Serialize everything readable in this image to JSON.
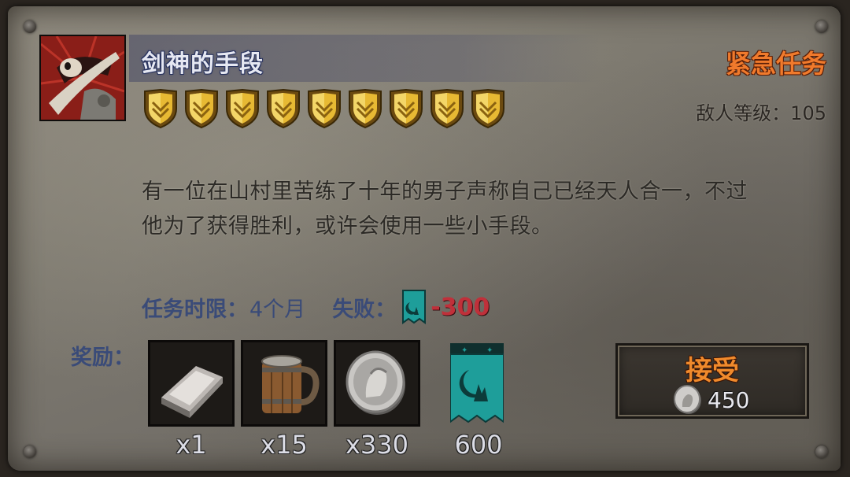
{
  "quest": {
    "title": "剑神的手段",
    "urgency": "紧急任务",
    "enemy_level": "敌人等级：105",
    "difficulty_shields": 9,
    "description_line1": "有一位在山村里苦练了十年的男子声称自己已经天人合一，不过",
    "description_line2": "他为了获得胜利，或许会使用一些小手段。",
    "time_limit_label": "任务时限：",
    "time_limit_value": "4个月",
    "fail_label": "失败：",
    "fail_penalty": "-300"
  },
  "rewards": {
    "label": "奖励：",
    "items": [
      {
        "icon": "silver-ingot-icon",
        "count": "x1"
      },
      {
        "icon": "wooden-mug-icon",
        "count": "x15"
      },
      {
        "icon": "silver-coin-icon",
        "count": "x330"
      },
      {
        "icon": "reputation-banner-icon",
        "count": "600"
      }
    ]
  },
  "accept_button": {
    "label": "接受",
    "cost": "450",
    "cost_icon": "silver-coin-icon"
  },
  "colors": {
    "title_blue": "#e6e8f2",
    "urgent_orange": "#f07a2c",
    "label_blue": "#3a4b78",
    "penalty_red": "#c0303a",
    "banner_teal": "#1e9e9a"
  }
}
